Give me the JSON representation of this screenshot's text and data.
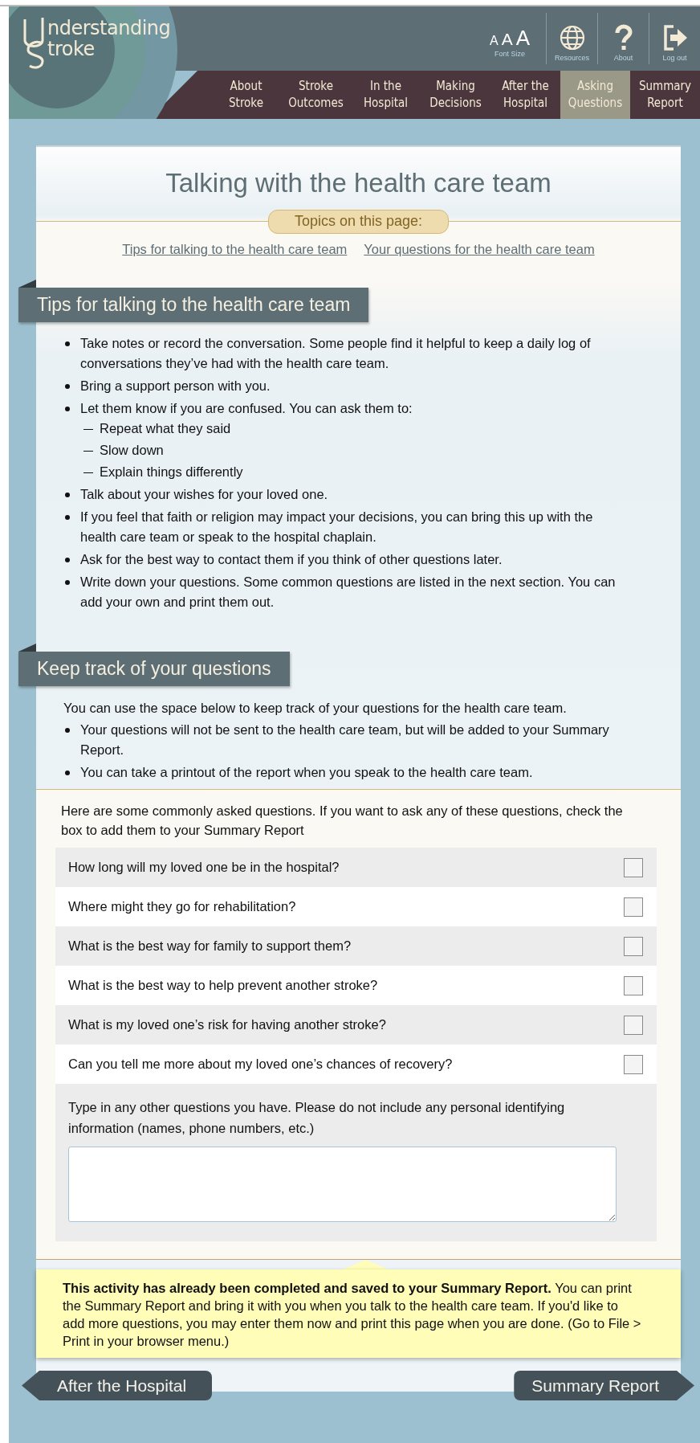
{
  "logo": {
    "line1": "nderstanding",
    "line2": "troke"
  },
  "toolbar": {
    "font_sizes": [
      "A",
      "A",
      "A"
    ],
    "font_size_label": "Font Size",
    "buttons": [
      {
        "kind": "globe",
        "label": "Resources"
      },
      {
        "kind": "help",
        "label": "About"
      },
      {
        "kind": "logout",
        "label": "Log out"
      }
    ]
  },
  "nav": [
    {
      "lines": [
        "About",
        "Stroke"
      ],
      "selected": false
    },
    {
      "lines": [
        "Stroke",
        "Outcomes"
      ],
      "selected": false
    },
    {
      "lines": [
        "In the",
        "Hospital"
      ],
      "selected": false
    },
    {
      "lines": [
        "Making",
        "Decisions"
      ],
      "selected": false
    },
    {
      "lines": [
        "After the",
        "Hospital"
      ],
      "selected": false
    },
    {
      "lines": [
        "Asking",
        "Questions"
      ],
      "selected": true
    },
    {
      "lines": [
        "Summary",
        "Report"
      ],
      "selected": false
    }
  ],
  "title": "Talking with the health care team",
  "topics": {
    "label": "Topics on this page:",
    "links": [
      "Tips for talking to the health care team",
      "Your questions for the health care team"
    ]
  },
  "sections": [
    {
      "heading": "Tips for talking to the health care team",
      "bullets": [
        {
          "text": "Take notes or record the conversation. Some people find it helpful to keep a daily log of conversations they’ve had with the health care team."
        },
        {
          "text": "Bring a support person with you."
        },
        {
          "text": "Let them know if you are confused. You can ask them to:",
          "children": [
            {
              "text": "Repeat what they said"
            },
            {
              "text": "Slow down"
            },
            {
              "text": "Explain things differently"
            }
          ]
        },
        {
          "text": "Talk about your wishes for your loved one."
        },
        {
          "text": "If you feel that faith or religion may impact your decisions, you can bring this up with the health care team or speak to the hospital chaplain."
        },
        {
          "text": "Ask for the best way to contact them if you think of other questions later."
        },
        {
          "text": "Write down your questions. Some common questions are listed in the next section. You can add your own and print them out."
        }
      ]
    },
    {
      "heading": "Keep track of your questions",
      "intro": "You can use the space below to keep track of your questions for the health care team.",
      "bullets": [
        {
          "text": "Your questions will not be sent to the health care team, but will be added to your Summary Report."
        },
        {
          "text": "You can take a printout of the report when you speak to the health care team."
        }
      ]
    }
  ],
  "questions": {
    "intro": "Here are some commonly asked questions. If you want to ask any of these questions, check the box to add them to your Summary Report",
    "items": [
      {
        "text": "How long will my loved one be in the hospital?",
        "checked": false
      },
      {
        "text": "Where might they go for rehabilitation?",
        "checked": false
      },
      {
        "text": "What is the best way for family to support them?",
        "checked": false
      },
      {
        "text": "What is the best way to help prevent another stroke?",
        "checked": false
      },
      {
        "text": "What is my loved one’s risk for having another stroke?",
        "checked": false
      },
      {
        "text": "Can you tell me more about my loved one’s chances of recovery?",
        "checked": false
      }
    ],
    "other_label": "Type in any other questions you have. Please do not include any personal identifying information (names, phone numbers, etc.)"
  },
  "note": "**This activity has already been completed and saved to your Summary Report.** You can print the Summary Report and bring it with you when you talk to the health care team. If you'd like to add more questions, you may enter them now and print this page when you are done. (Go to File > Print in your browser menu.)",
  "footer": {
    "prev": "After the Hospital",
    "next": "Summary Report"
  }
}
